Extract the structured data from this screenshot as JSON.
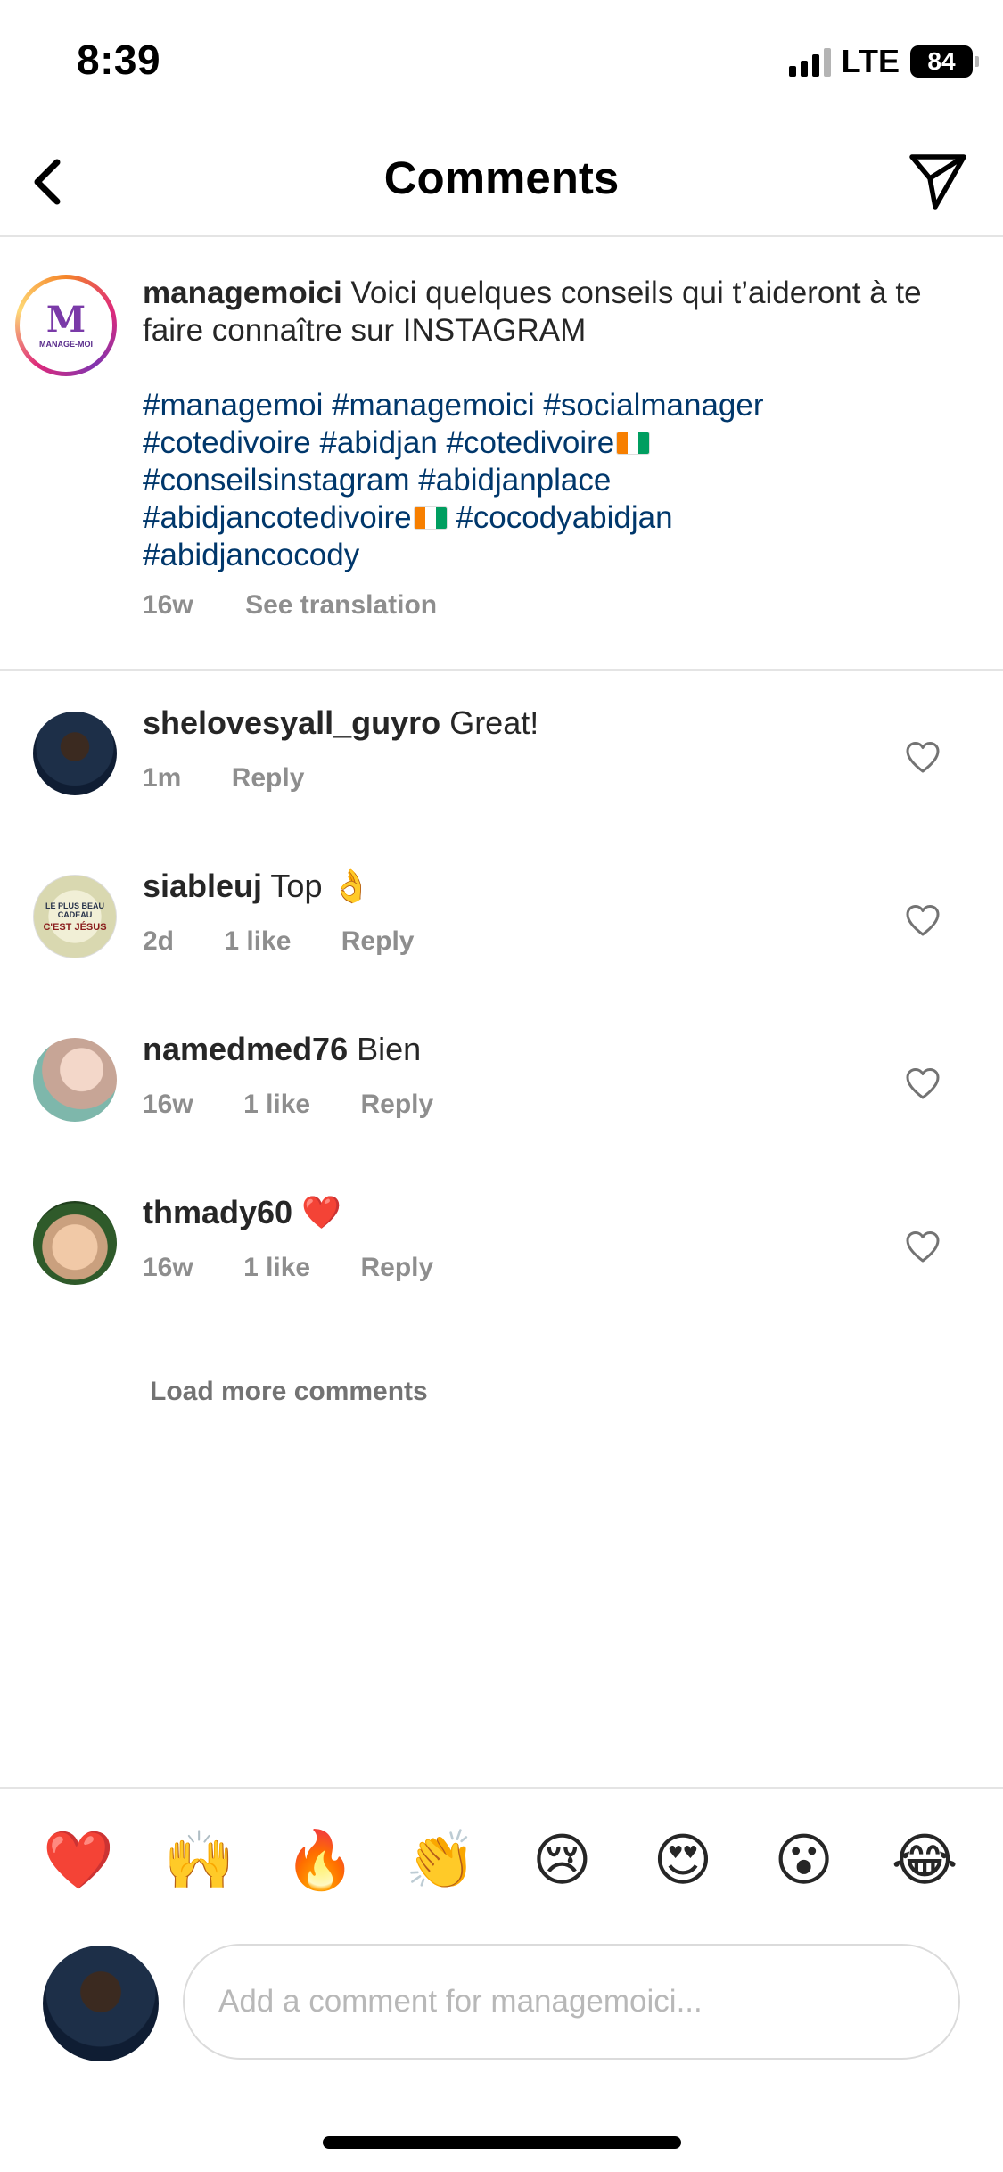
{
  "status_bar": {
    "time": "8:39",
    "network": "LTE",
    "battery": "84"
  },
  "header": {
    "title": "Comments",
    "back_icon": "chevron-left-icon",
    "share_icon": "paper-plane-icon"
  },
  "caption": {
    "username": "managemoici",
    "text": "Voici quelques conseils qui t’aideront à te faire connaître sur INSTAGRAM",
    "hashtags_line1": "#managemoi #managemoici #socialmanager",
    "hashtags_line2": "#cotedivoire #abidjan #cotedivoire",
    "hashtags_line3": "#conseilsinstagram #abidjanplace",
    "hashtags_line4a": "#abidjancotedivoire",
    "hashtags_line4b": " #cocodyabidjan",
    "hashtags_line5": "#abidjancocody",
    "time": "16w",
    "translate": "See translation",
    "avatar_logo": "M",
    "avatar_logo_sub": "MANAGE-MOI"
  },
  "comments": [
    {
      "username": "shelovesyall_guyro",
      "text": "Great!",
      "time": "1m",
      "likes": "",
      "reply": "Reply"
    },
    {
      "username": "siableuj",
      "text": "Top 👌",
      "time": "2d",
      "likes": "1 like",
      "reply": "Reply",
      "avatar_text1": "LE PLUS BEAU CADEAU",
      "avatar_text2": "C'EST JÉSUS"
    },
    {
      "username": "namedmed76",
      "text": "Bien",
      "time": "16w",
      "likes": "1 like",
      "reply": "Reply"
    },
    {
      "username": "thmady60",
      "text": "❤️",
      "time": "16w",
      "likes": "1 like",
      "reply": "Reply"
    }
  ],
  "load_more": "Load more comments",
  "emoji_bar": [
    "❤️",
    "🙌",
    "🔥",
    "👏",
    "😢",
    "😍",
    "😮",
    "😂"
  ],
  "composer": {
    "placeholder": "Add a comment for managemoici..."
  },
  "colors": {
    "hashtag": "#00376b",
    "meta": "#8e8e8e",
    "divider": "#e4e4e4"
  }
}
